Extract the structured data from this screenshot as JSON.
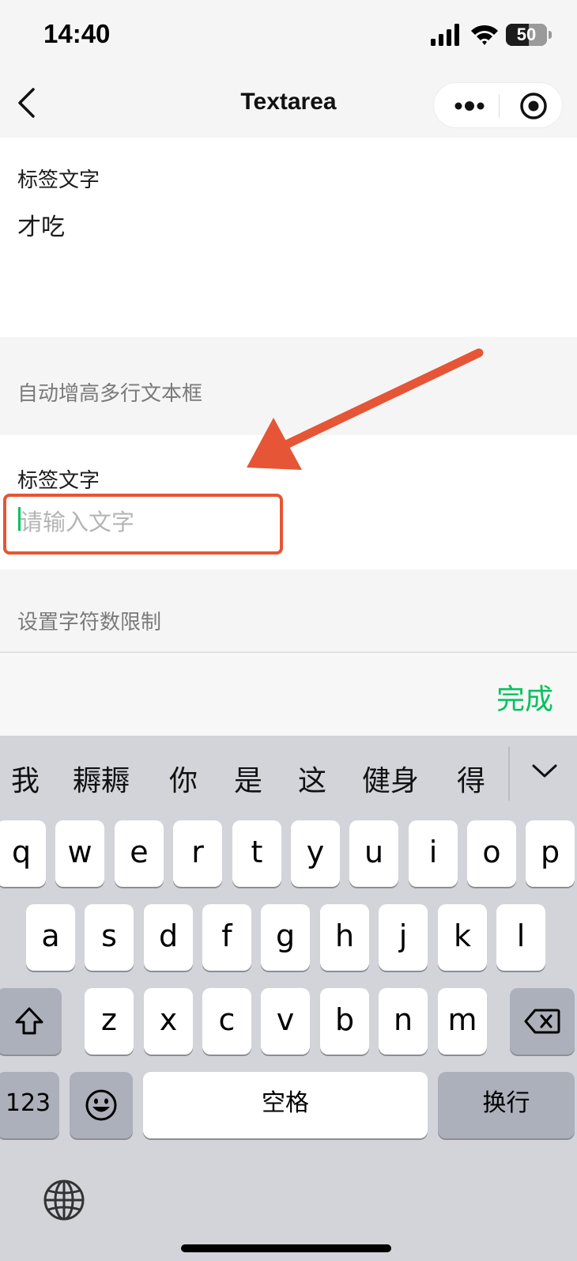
{
  "status_bar": {
    "time": "14:40",
    "battery": "50"
  },
  "nav": {
    "title": "Textarea",
    "icons": [
      "back-icon",
      "more-icon",
      "record-icon"
    ]
  },
  "content": {
    "field1": {
      "label": "标签文字",
      "value": "才吃"
    },
    "section_auto_height": "自动增高多行文本框",
    "field2": {
      "label": "标签文字",
      "placeholder": "请输入文字"
    },
    "section_char_limit": "设置字符数限制"
  },
  "accessory": {
    "done_label": "完成"
  },
  "keyboard": {
    "candidates": [
      "我",
      "耨耨",
      "你",
      "是",
      "这",
      "健身",
      "得"
    ],
    "row1": [
      "q",
      "w",
      "e",
      "r",
      "t",
      "y",
      "u",
      "i",
      "o",
      "p"
    ],
    "row2": [
      "a",
      "s",
      "d",
      "f",
      "g",
      "h",
      "j",
      "k",
      "l"
    ],
    "row3": [
      "z",
      "x",
      "c",
      "v",
      "b",
      "n",
      "m"
    ],
    "numbers_label": "123",
    "space_label": "空格",
    "return_label": "换行"
  },
  "colors": {
    "accent_green": "#07c160",
    "annotation_red": "#e65535",
    "keyboard_bg": "#d2d4da"
  }
}
